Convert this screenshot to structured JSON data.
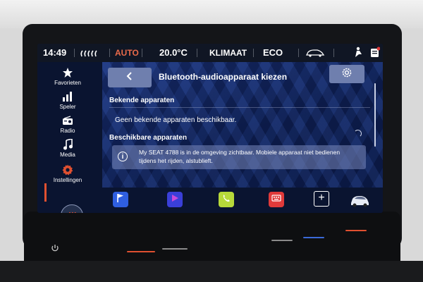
{
  "status_bar": {
    "time": "14:49",
    "auto": "AUTO",
    "temperature": "20.0°C",
    "climate": "KLIMAAT",
    "eco": "ECO",
    "icons": [
      "seat-heat-icon",
      "car-profile-icon",
      "person-seat-icon",
      "notification-icon"
    ]
  },
  "sidebar": {
    "items": [
      {
        "label": "Favorieten",
        "icon": "star-icon"
      },
      {
        "label": "Speler",
        "icon": "equalizer-icon"
      },
      {
        "label": "Radio",
        "icon": "radio-icon"
      },
      {
        "label": "Media",
        "icon": "music-note-icon"
      },
      {
        "label": "Instellingen",
        "icon": "gear-icon",
        "active": true
      }
    ],
    "home_button_label": "///"
  },
  "main": {
    "title": "Bluetooth-audioapparaat kiezen",
    "known_header": "Bekende apparaten",
    "no_known_msg": "Geen bekende apparaten beschikbaar.",
    "available_header": "Beschikbare apparaten",
    "notice": "My SEAT 4788 is in de omgeving zichtbaar. Mobiele apparaat niet bedienen tijdens het rijden, alstublieft."
  },
  "dock": {
    "apps": [
      {
        "icon": "flag-icon",
        "color": "#2f5fe0"
      },
      {
        "icon": "play-icon",
        "color": "#3a3fd8"
      },
      {
        "icon": "phone-icon",
        "color": "#b7d93a"
      },
      {
        "icon": "keyboard-icon",
        "color": "#e03a3a"
      }
    ],
    "add_label": "+"
  },
  "colors": {
    "accent": "#e05030",
    "screen_bg": "#0b1a3a",
    "button_bg": "#6f7fae"
  }
}
